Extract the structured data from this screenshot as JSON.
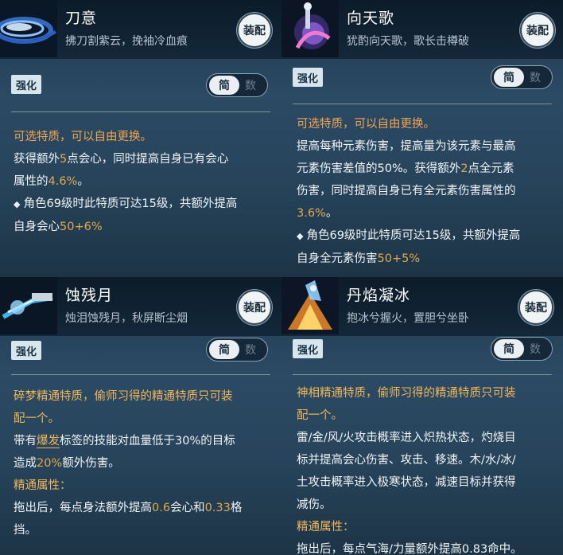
{
  "panels": [
    {
      "name": "刀意",
      "subtitle": "拂刀割紫云，挽袖冷血痕",
      "equip": "装配",
      "tag": "强化",
      "toggle": {
        "on": "简",
        "off": "数"
      },
      "body": {
        "intro": "可选特质，可以自由更换。",
        "l1": "获得额外",
        "n1": "5",
        "l2": "点会心，同时提高自身已有会心",
        "l3": "属性的",
        "n2": "4.6%",
        "l4": "。",
        "b1": "角色69级时此特质可达15级，共额外提高",
        "b2": "自身会心",
        "n3": "50+6%"
      }
    },
    {
      "name": "向天歌",
      "subtitle": "犹酌向天歌，歌长击樽破",
      "equip": "装配",
      "tag": "强化",
      "toggle": {
        "on": "简",
        "off": "数"
      },
      "body": {
        "intro": "可选特质，可以自由更换。",
        "l1": "提高每种元素伤害，提高量为该元素与最高",
        "l2a": "元素伤害差值的50%。获得额外",
        "n1": "2",
        "l2b": "点全元素",
        "l3": "伤害，同时提高自身已有全元素伤害属性的",
        "n2": "3.6%",
        "l4": "。",
        "b1": "角色69级时此特质可达15级，共额外提高",
        "b2": "自身全元素伤害",
        "n3": "50+5%"
      }
    },
    {
      "name": "蚀残月",
      "subtitle": "烛泪蚀残月，秋屏断尘烟",
      "equip": "装配",
      "tag": "强化",
      "toggle": {
        "on": "简",
        "off": "数"
      },
      "body": {
        "intro1": "碎梦精通特质，偷师习得的精通特质只可装",
        "intro2": "配一个。",
        "l1a": "带有",
        "k1": "爆发",
        "l1b": "标签的技能对血量低于30%的目标",
        "l2a": "造成",
        "n1": "20%",
        "l2b": "额外伤害。",
        "attr": "精通属性：",
        "l3a": "拖出后，每点身法额外提高",
        "n2": "0.6",
        "l3b": "会心和",
        "n3": "0.33",
        "l3c": "格",
        "l4": "挡。"
      }
    },
    {
      "name": "丹焰凝冰",
      "subtitle": "抱冰兮握火，置胆兮坐卧",
      "equip": "装配",
      "tag": "强化",
      "toggle": {
        "on": "简",
        "off": "数"
      },
      "body": {
        "intro1": "神相精通特质，偷师习得的精通特质只可装",
        "intro2": "配一个。",
        "l1": "雷/金/风/火攻击概率进入炽热状态，灼烧目",
        "l2": "标并提高会心伤害、攻击、移速。木/水/冰/",
        "l3": "土攻击概率进入极寒状态，减速目标并获得",
        "l4": "减伤。",
        "attr": "精通属性：",
        "l5": "拖出后，每点气海/力量额外提高0.83命中。"
      }
    }
  ]
}
